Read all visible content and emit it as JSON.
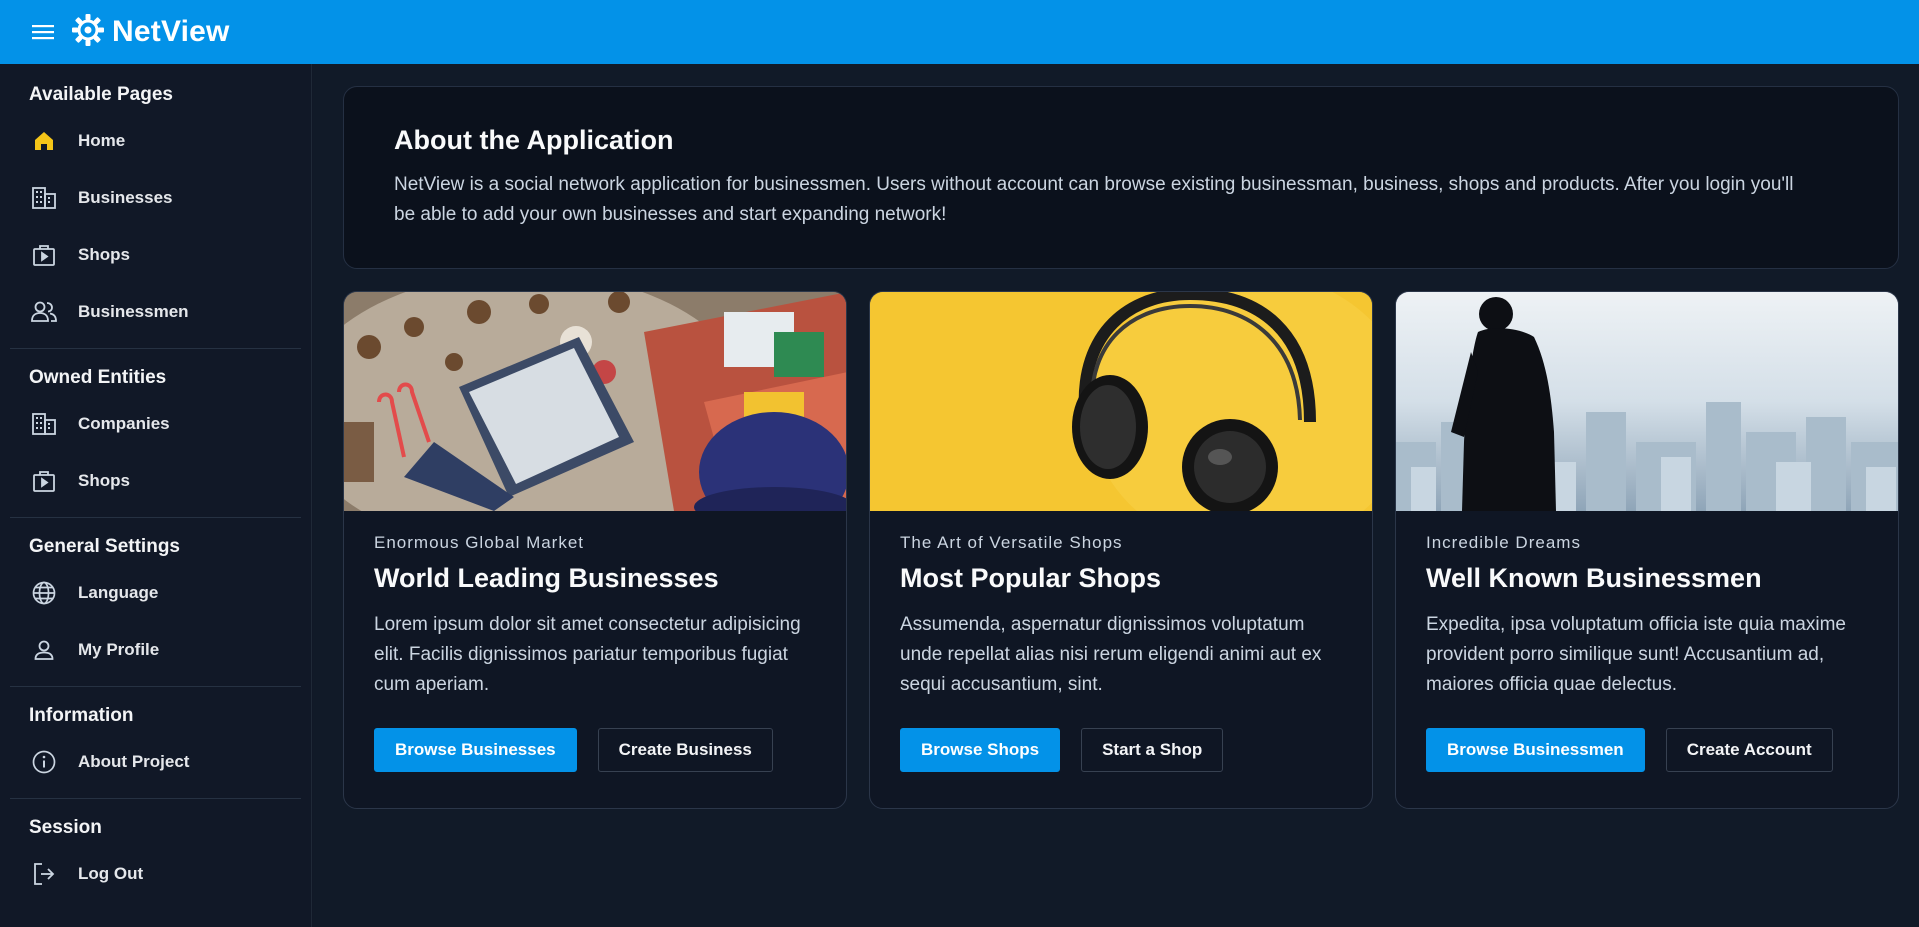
{
  "app": {
    "name": "NetView",
    "brand_color": "#0392e8"
  },
  "header": {
    "menu_icon": "hamburger-icon",
    "logo_icon": "gear-icon"
  },
  "sidebar": {
    "sections": [
      {
        "title": "Available Pages",
        "items": [
          {
            "label": "Home",
            "icon": "home-icon",
            "active": true
          },
          {
            "label": "Businesses",
            "icon": "building-icon"
          },
          {
            "label": "Shops",
            "icon": "shop-icon"
          },
          {
            "label": "Businessmen",
            "icon": "users-icon"
          }
        ]
      },
      {
        "title": "Owned Entities",
        "items": [
          {
            "label": "Companies",
            "icon": "building-icon"
          },
          {
            "label": "Shops",
            "icon": "shop-icon"
          }
        ]
      },
      {
        "title": "General Settings",
        "items": [
          {
            "label": "Language",
            "icon": "globe-icon"
          },
          {
            "label": "My Profile",
            "icon": "user-icon"
          }
        ]
      },
      {
        "title": "Information",
        "items": [
          {
            "label": "About Project",
            "icon": "info-icon"
          }
        ]
      },
      {
        "title": "Session",
        "items": [
          {
            "label": "Log Out",
            "icon": "logout-icon"
          }
        ]
      }
    ]
  },
  "about": {
    "title": "About the Application",
    "text": "NetView is a social network application for businessmen. Users without account can browse existing businessman, business, shops and products. After you login you'll be able to add your own businesses and start expanding network!"
  },
  "cards": [
    {
      "kicker": "Enormous Global Market",
      "title": "World Leading Businesses",
      "text": "Lorem ipsum dolor sit amet consectetur adipisicing elit. Facilis dignissimos pariatur temporibus fugiat cum aperiam.",
      "primary": "Browse Businesses",
      "secondary": "Create Business",
      "image": "laptop-christmas-photo"
    },
    {
      "kicker": "The Art of Versatile Shops",
      "title": "Most Popular Shops",
      "text": "Assumenda, aspernatur dignissimos voluptatum unde repellat alias nisi rerum eligendi animi aut ex sequi accusantium, sint.",
      "primary": "Browse Shops",
      "secondary": "Start a Shop",
      "image": "headphones-photo"
    },
    {
      "kicker": "Incredible Dreams",
      "title": "Well Known Businessmen",
      "text": "Expedita, ipsa voluptatum officia iste quia maxime provident porro similique sunt! Accusantium ad, maiores officia quae delectus.",
      "primary": "Browse Businessmen",
      "secondary": "Create Account",
      "image": "businessman-city-photo"
    }
  ]
}
